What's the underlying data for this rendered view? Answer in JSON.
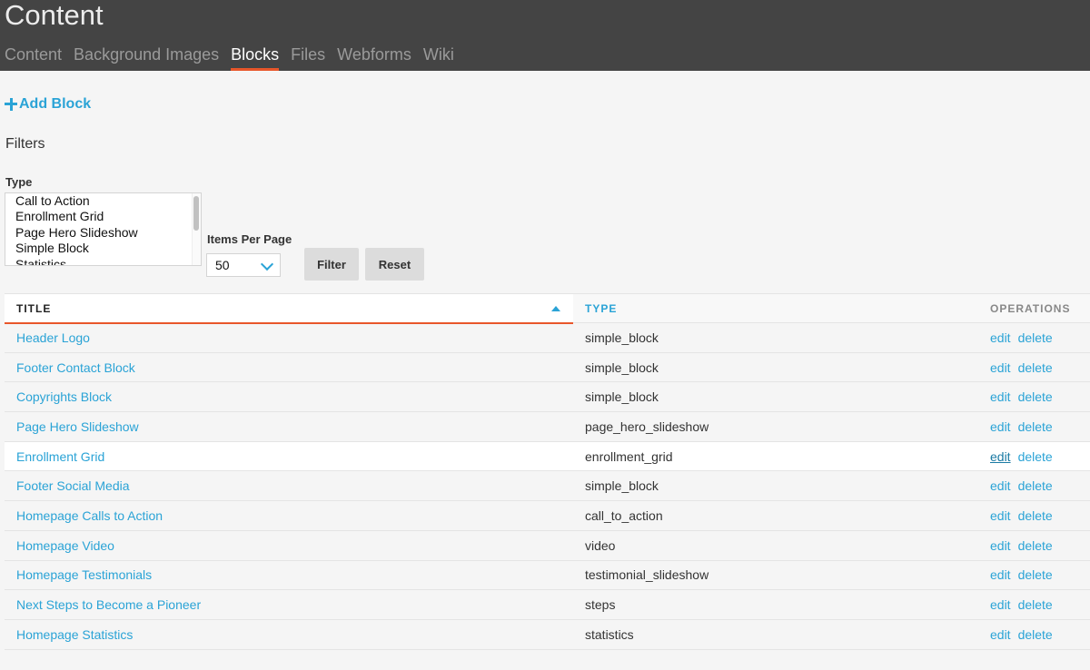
{
  "header": {
    "title": "Content",
    "tabs": [
      {
        "label": "Content"
      },
      {
        "label": "Background Images"
      },
      {
        "label": "Blocks"
      },
      {
        "label": "Files"
      },
      {
        "label": "Webforms"
      },
      {
        "label": "Wiki"
      }
    ],
    "active_tab": "Blocks"
  },
  "actions": {
    "add_block_label": "Add Block"
  },
  "filters": {
    "title": "Filters",
    "type_label": "Type",
    "type_options": [
      "Call to Action",
      "Enrollment Grid",
      "Page Hero Slideshow",
      "Simple Block",
      "Statistics"
    ],
    "items_per_page_label": "Items Per Page",
    "items_per_page_value": "50",
    "filter_button": "Filter",
    "reset_button": "Reset"
  },
  "table": {
    "headers": {
      "title": "TITLE",
      "type": "TYPE",
      "operations": "OPERATIONS"
    },
    "sorted_column": "title",
    "sort_direction": "asc",
    "rows": [
      {
        "title": "Header Logo",
        "type": "simple_block",
        "edit": "edit",
        "delete": "delete"
      },
      {
        "title": "Footer Contact Block",
        "type": "simple_block",
        "edit": "edit",
        "delete": "delete"
      },
      {
        "title": "Copyrights Block",
        "type": "simple_block",
        "edit": "edit",
        "delete": "delete"
      },
      {
        "title": "Page Hero Slideshow",
        "type": "page_hero_slideshow",
        "edit": "edit",
        "delete": "delete"
      },
      {
        "title": "Enrollment Grid",
        "type": "enrollment_grid",
        "edit": "edit",
        "delete": "delete"
      },
      {
        "title": "Footer Social Media",
        "type": "simple_block",
        "edit": "edit",
        "delete": "delete"
      },
      {
        "title": "Homepage Calls to Action",
        "type": "call_to_action",
        "edit": "edit",
        "delete": "delete"
      },
      {
        "title": "Homepage Video",
        "type": "video",
        "edit": "edit",
        "delete": "delete"
      },
      {
        "title": "Homepage Testimonials",
        "type": "testimonial_slideshow",
        "edit": "edit",
        "delete": "delete"
      },
      {
        "title": "Next Steps to Become a Pioneer",
        "type": "steps",
        "edit": "edit",
        "delete": "delete"
      },
      {
        "title": "Homepage Statistics",
        "type": "statistics",
        "edit": "edit",
        "delete": "delete"
      }
    ],
    "hovered_row_index": 4
  },
  "colors": {
    "header_bg": "#444444",
    "accent_orange": "#e8562a",
    "link_blue": "#2aa3d6",
    "page_bg": "#f5f5f5"
  }
}
